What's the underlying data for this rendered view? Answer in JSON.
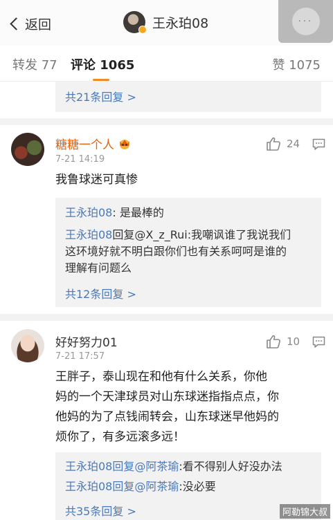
{
  "nav": {
    "back_label": "返回",
    "title": "王永珀08",
    "more_label": "···"
  },
  "tabs": {
    "repost": "转发 77",
    "comment": "评论 1065",
    "like": "赞 1075"
  },
  "top_reply": {
    "more_replies": "共21条回复 >"
  },
  "comments": [
    {
      "username": "糖糖一个人",
      "username_color": "#e8600a",
      "badge_icon": "crown-badge-icon",
      "time": "7-21 14:19",
      "like_count": "24",
      "text_lines": [
        "我鲁球迷可真惨"
      ],
      "replies": [
        {
          "author": "王永珀08",
          "lines": [
            ": 是最棒的"
          ]
        },
        {
          "author": "王永珀08",
          "mention": "回复@X_z_Rui",
          "lines": [
            ":我嘲讽谁了我说我们",
            "这环境好就不明白跟你们也有关系呵呵是谁的",
            "理解有问题么"
          ]
        }
      ],
      "more_replies": "共12条回复 >"
    },
    {
      "username": "好好努力01",
      "username_color": "#333333",
      "time": "7-21 17:57",
      "like_count": "10",
      "text_lines": [
        "王胖子，泰山现在和他有什么关系，你他",
        "妈的一个天津球员对山东球迷指指点点，你",
        "他妈的为了点钱闹转会，山东球迷早他妈的",
        "烦你了，有多远滚多远！"
      ],
      "replies": [
        {
          "author": "王永珀08",
          "mention": "回复@阿茶瑜",
          "lines": [
            ":看不得别人好没办法"
          ]
        },
        {
          "author": "王永珀08",
          "mention": "回复@阿茶瑜",
          "lines": [
            ":没必要"
          ]
        }
      ],
      "more_replies": "共35条回复 >"
    }
  ],
  "watermark": "阿勒锦大叔",
  "colors": {
    "link": "#4a78b8",
    "accent": "#f08a24",
    "reply_bg": "#f2f2f2"
  }
}
